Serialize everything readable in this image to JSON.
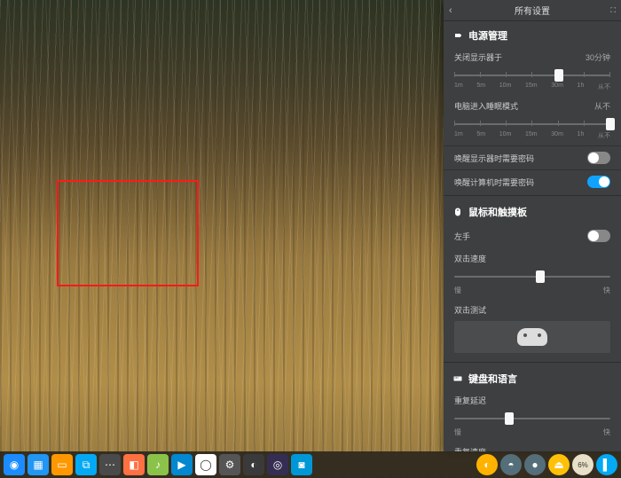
{
  "panel": {
    "title": "所有设置",
    "sections": {
      "power": {
        "title": "电源管理",
        "turnoff_display": {
          "label": "关闭显示器于",
          "value": "30分钟",
          "ticks": [
            "1m",
            "5m",
            "10m",
            "15m",
            "30m",
            "1h",
            "从不"
          ],
          "pos": 67
        },
        "sleep": {
          "label": "电脑进入睡眠模式",
          "value": "从不",
          "ticks": [
            "1m",
            "5m",
            "10m",
            "15m",
            "30m",
            "1h",
            "从不"
          ],
          "pos": 100
        },
        "wake_display_pw": {
          "label": "唤醒显示器时需要密码",
          "on": false
        },
        "wake_computer_pw": {
          "label": "唤醒计算机时需要密码",
          "on": true
        }
      },
      "mouse": {
        "title": "鼠标和触摸板",
        "left_hand": {
          "label": "左手",
          "on": false
        },
        "dbl_speed": {
          "label": "双击速度",
          "low": "慢",
          "high": "快",
          "pos": 55
        },
        "dbl_test": {
          "label": "双击测试"
        }
      },
      "keyboard": {
        "title": "键盘和语言",
        "repeat_delay": {
          "label": "重复延迟",
          "low": "慢",
          "high": "快",
          "pos": 35
        },
        "repeat_rate": {
          "label": "重复速度"
        }
      }
    }
  },
  "taskbar": {
    "left": [
      {
        "name": "launcher-icon",
        "bg": "#1a8cff",
        "glyph": "◉"
      },
      {
        "name": "workspace-icon",
        "bg": "#2196f3",
        "glyph": "▦"
      },
      {
        "name": "files-icon",
        "bg": "#ff9800",
        "glyph": "▭"
      },
      {
        "name": "app1-icon",
        "bg": "#03a9f4",
        "glyph": "⧉"
      },
      {
        "name": "app2-icon",
        "bg": "#4a4a4a",
        "glyph": "⋯"
      },
      {
        "name": "store-icon",
        "bg": "#ff7043",
        "glyph": "◧"
      },
      {
        "name": "music-icon",
        "bg": "#8bc34a",
        "glyph": "♪"
      },
      {
        "name": "video-icon",
        "bg": "#0288d1",
        "glyph": "▶"
      },
      {
        "name": "chrome-icon",
        "bg": "#ffffff",
        "glyph": "◯"
      },
      {
        "name": "settings-icon",
        "bg": "#555555",
        "glyph": "⚙"
      },
      {
        "name": "app3-icon",
        "bg": "#3a3a3a",
        "glyph": "◐"
      },
      {
        "name": "app4-icon",
        "bg": "#352e52",
        "glyph": "◎"
      },
      {
        "name": "camera-icon",
        "bg": "#0097d6",
        "glyph": "◙"
      }
    ],
    "right": [
      {
        "name": "tray1-icon",
        "bg": "#ffb300",
        "glyph": "◐"
      },
      {
        "name": "tray2-icon",
        "bg": "#546e7a",
        "glyph": "◓"
      },
      {
        "name": "tray3-icon",
        "bg": "#546e7a",
        "glyph": "●"
      },
      {
        "name": "eject-icon",
        "bg": "#ffc107",
        "glyph": "⏏"
      },
      {
        "name": "disk-icon",
        "bg": "#e8e0c8",
        "glyph": "6%"
      },
      {
        "name": "tray4-icon",
        "bg": "#03a9f4",
        "glyph": "▌"
      }
    ]
  }
}
